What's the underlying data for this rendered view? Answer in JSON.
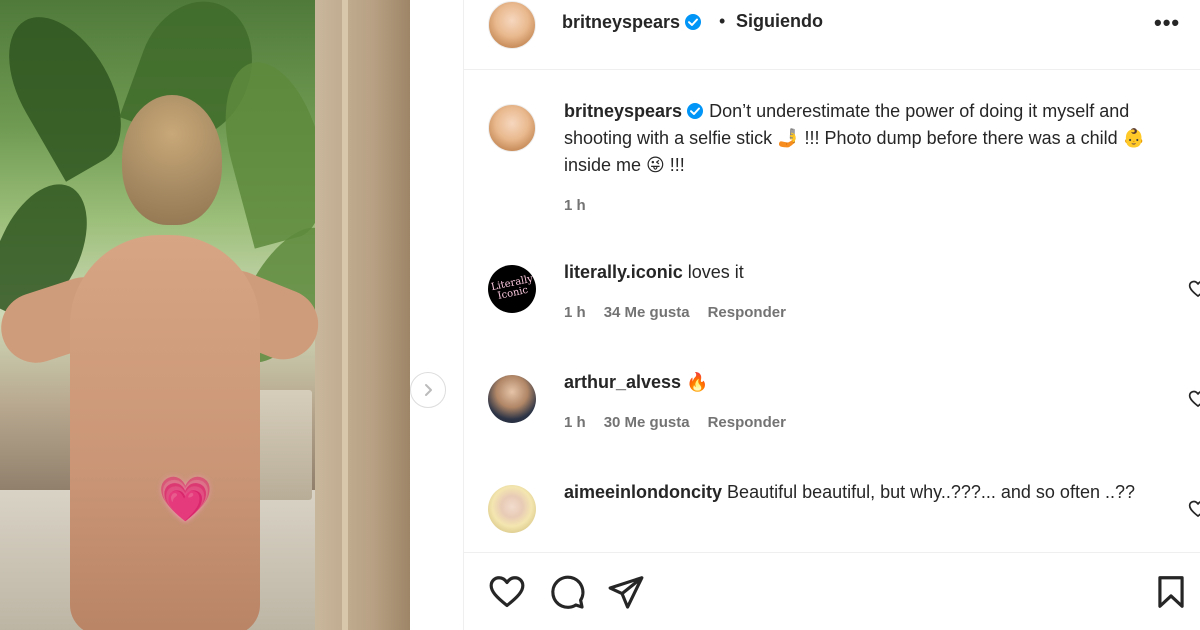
{
  "post": {
    "author": "britneyspears",
    "follow_status": "Siguiendo",
    "separator": "•",
    "more_label": "•••",
    "caption_text": "Don’t underestimate the power of doing it myself and shooting with a selfie stick 🤳 !!! Photo dump before there was a child 👶 inside me 😜 !!!",
    "caption_time": "1 h"
  },
  "comments": [
    {
      "user": "literally.iconic",
      "avatar_text": "Literally Iconic",
      "text": "loves it",
      "time": "1 h",
      "likes": "34 Me gusta",
      "reply": "Responder"
    },
    {
      "user": "arthur_alvess",
      "text": "🔥",
      "time": "1 h",
      "likes": "30 Me gusta",
      "reply": "Responder"
    },
    {
      "user": "aimeeinlondoncity",
      "text": "Beautiful beautiful, but why..???... and so often ..??"
    }
  ],
  "media": {
    "censor_emoji": "💗"
  },
  "icons": {
    "verified": "verified-badge-icon",
    "like": "heart-icon",
    "comment": "comment-icon",
    "share": "share-icon",
    "save": "bookmark-icon",
    "next": "chevron-right-icon"
  },
  "colors": {
    "verified": "#0095f6",
    "text": "#262626",
    "muted": "#737373",
    "divider": "#efefef"
  }
}
